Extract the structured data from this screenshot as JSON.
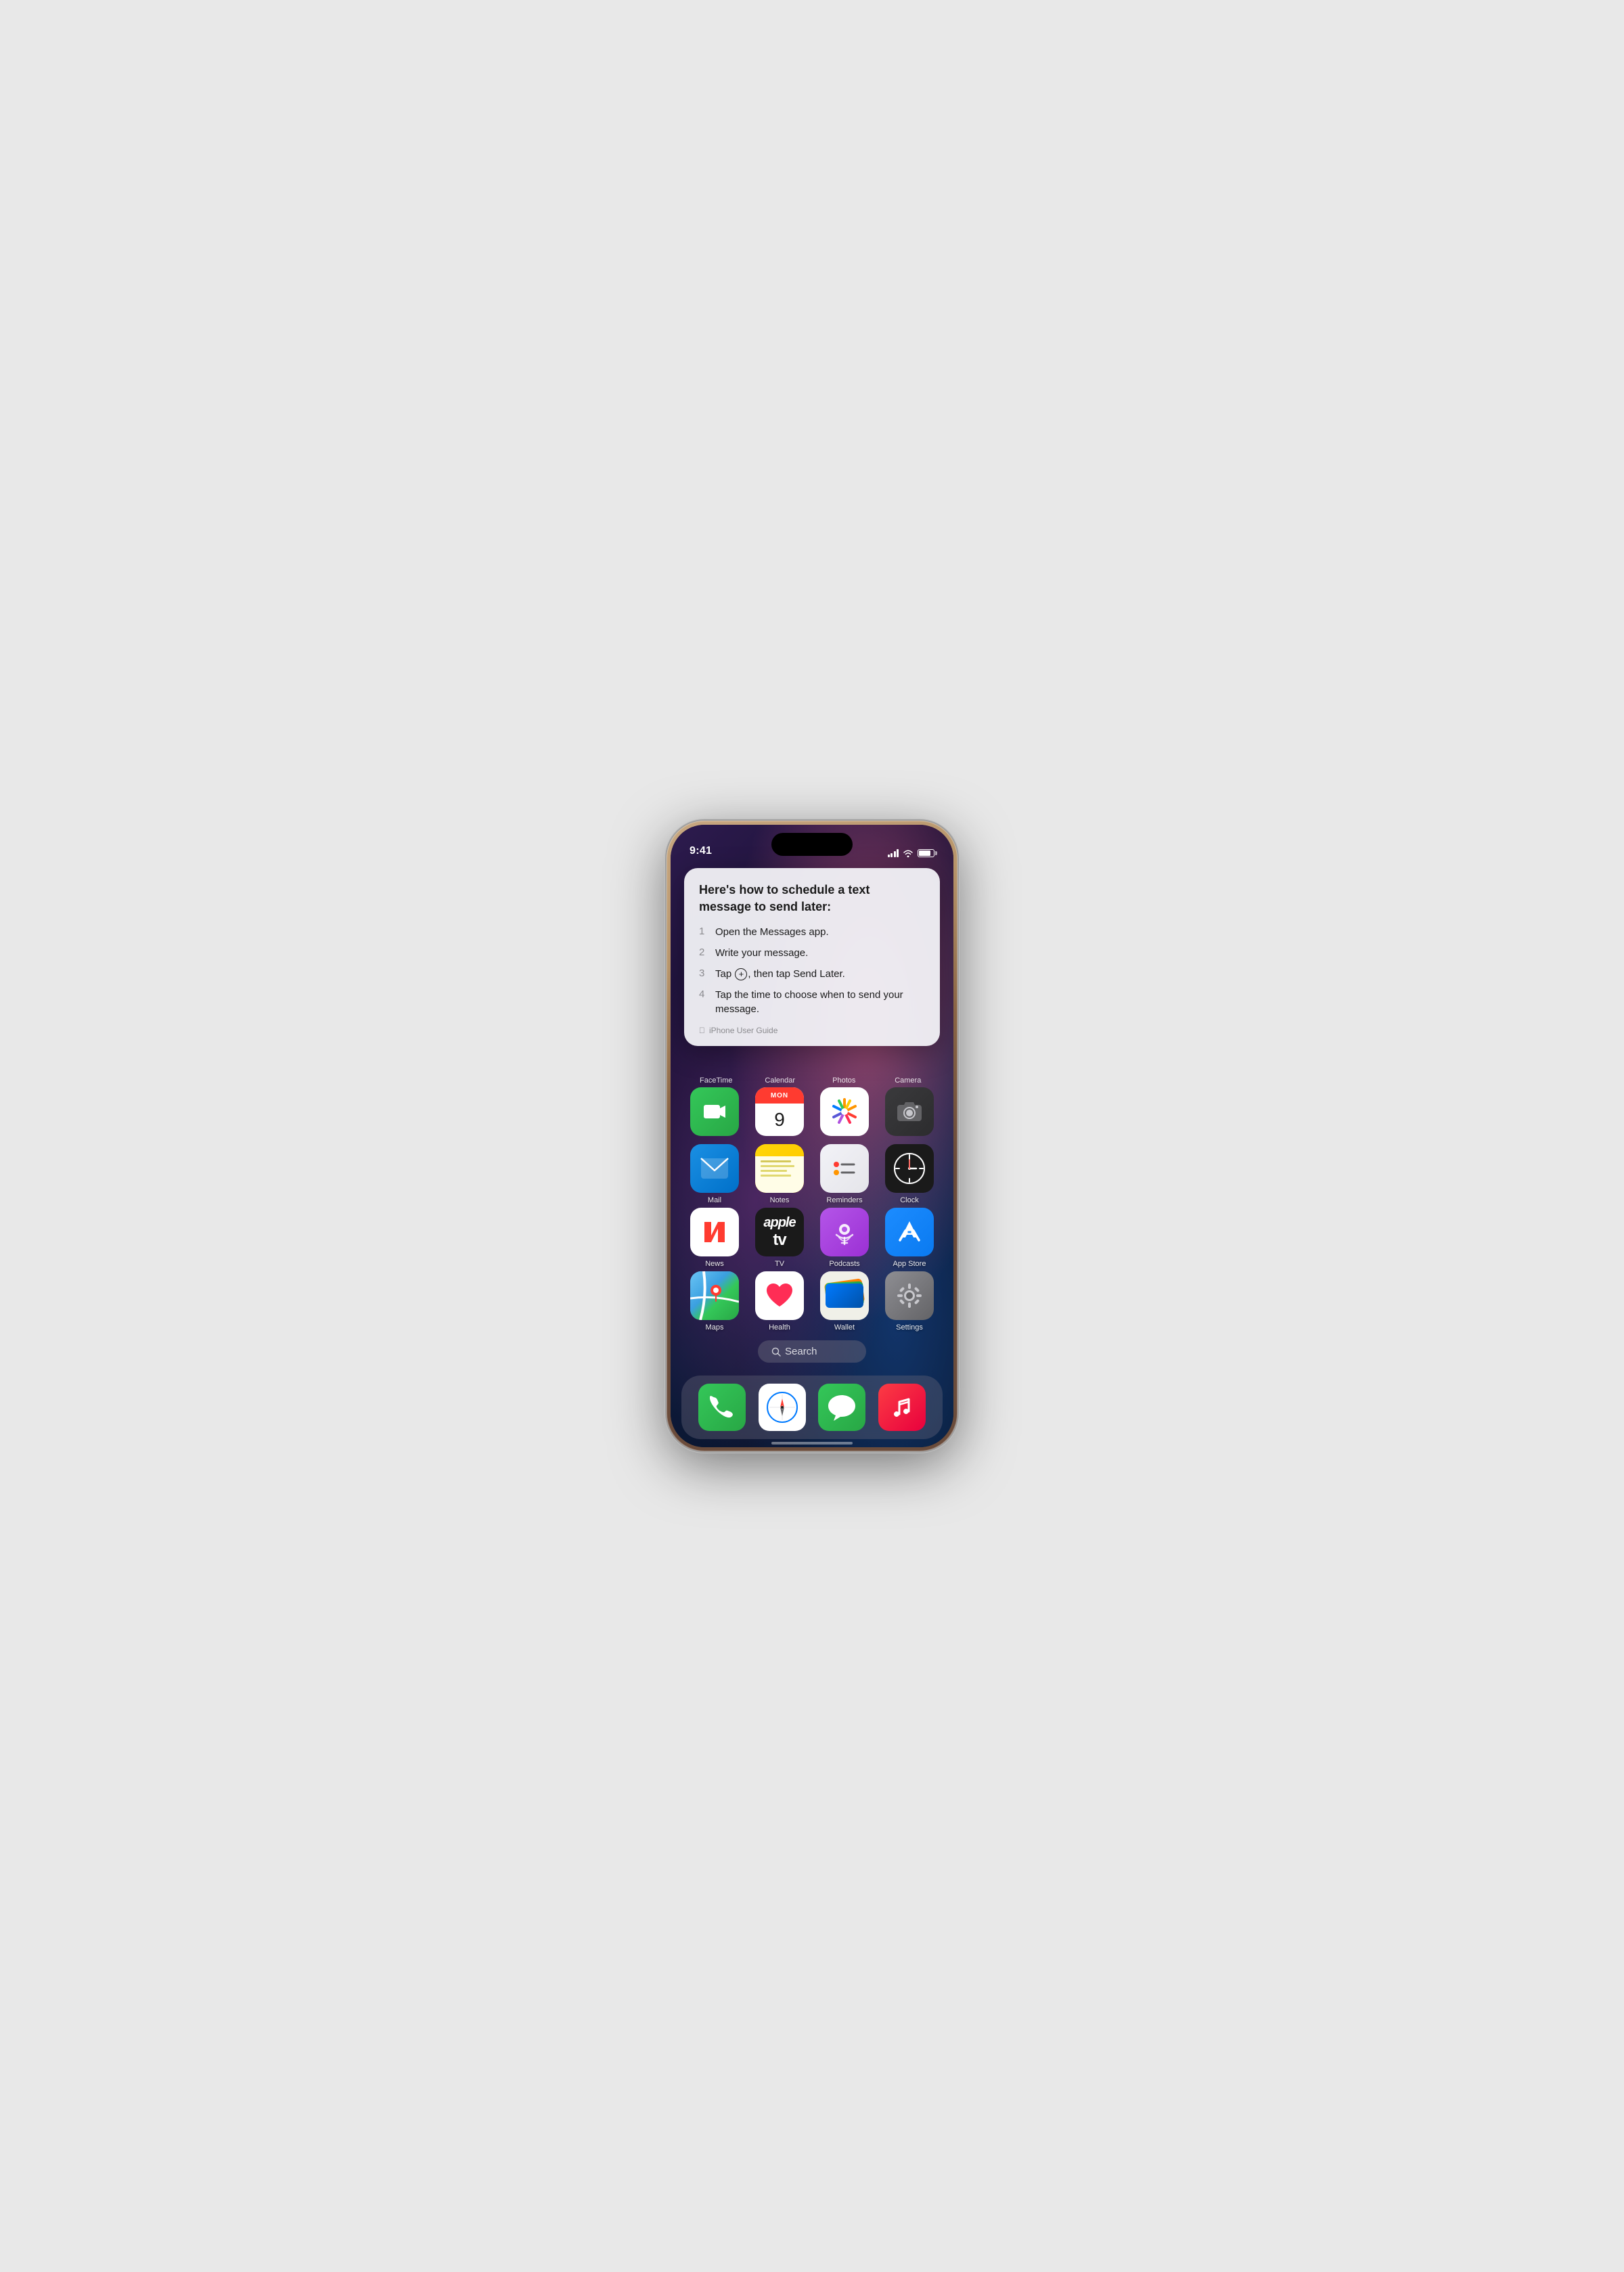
{
  "phone": {
    "time": "9:41",
    "wallpaper": "dark-space-gradient"
  },
  "notification": {
    "title": "Here's how to schedule a text message to send later:",
    "steps": [
      {
        "number": "1",
        "text": "Open the Messages app."
      },
      {
        "number": "2",
        "text": "Write your message."
      },
      {
        "number": "3",
        "text": "Tap ⊕, then tap Send Later.",
        "has_icon": true
      },
      {
        "number": "4",
        "text": "Tap the time to choose when to send your message."
      }
    ],
    "source": "iPhone User Guide"
  },
  "top_dock_labels": [
    "FaceTime",
    "Calendar",
    "Photos",
    "Camera"
  ],
  "app_rows": [
    [
      {
        "id": "mail",
        "label": "Mail",
        "icon_type": "mail"
      },
      {
        "id": "notes",
        "label": "Notes",
        "icon_type": "notes"
      },
      {
        "id": "reminders",
        "label": "Reminders",
        "icon_type": "reminders"
      },
      {
        "id": "clock",
        "label": "Clock",
        "icon_type": "clock"
      }
    ],
    [
      {
        "id": "news",
        "label": "News",
        "icon_type": "news"
      },
      {
        "id": "tv",
        "label": "TV",
        "icon_type": "tv"
      },
      {
        "id": "podcasts",
        "label": "Podcasts",
        "icon_type": "podcasts"
      },
      {
        "id": "appstore",
        "label": "App Store",
        "icon_type": "appstore"
      }
    ],
    [
      {
        "id": "maps",
        "label": "Maps",
        "icon_type": "maps"
      },
      {
        "id": "health",
        "label": "Health",
        "icon_type": "health"
      },
      {
        "id": "wallet",
        "label": "Wallet",
        "icon_type": "wallet"
      },
      {
        "id": "settings",
        "label": "Settings",
        "icon_type": "settings"
      }
    ]
  ],
  "search": {
    "label": "🔍 Search"
  },
  "dock_apps": [
    {
      "id": "phone",
      "label": "Phone",
      "icon_type": "phone"
    },
    {
      "id": "safari",
      "label": "Safari",
      "icon_type": "safari"
    },
    {
      "id": "messages",
      "label": "Messages",
      "icon_type": "messages"
    },
    {
      "id": "music",
      "label": "Music",
      "icon_type": "music"
    }
  ]
}
